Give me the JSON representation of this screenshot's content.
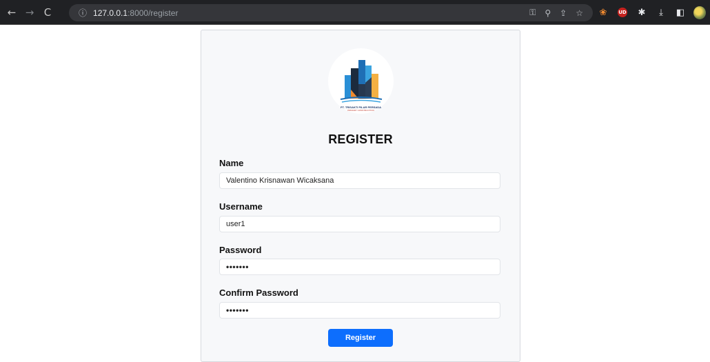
{
  "browser": {
    "url_host": "127.0.0.1",
    "url_path": ":8000/register",
    "ext_badge": "UD"
  },
  "logo": {
    "company": "PT. TRISAKTI PILAR PERSADA",
    "tagline": "PRIMARY CONSTRUCTION"
  },
  "form": {
    "title": "REGISTER",
    "name_label": "Name",
    "name_value": "Valentino Krisnawan Wicaksana",
    "username_label": "Username",
    "username_value": "user1",
    "password_label": "Password",
    "password_value": "•••••••",
    "confirm_label": "Confirm Password",
    "confirm_value": "•••••••",
    "submit_label": "Register"
  },
  "colors": {
    "chrome_bg": "#202124",
    "omnibox_bg": "#35363a",
    "card_bg": "#f7f8fa",
    "button": "#0d6efd"
  }
}
